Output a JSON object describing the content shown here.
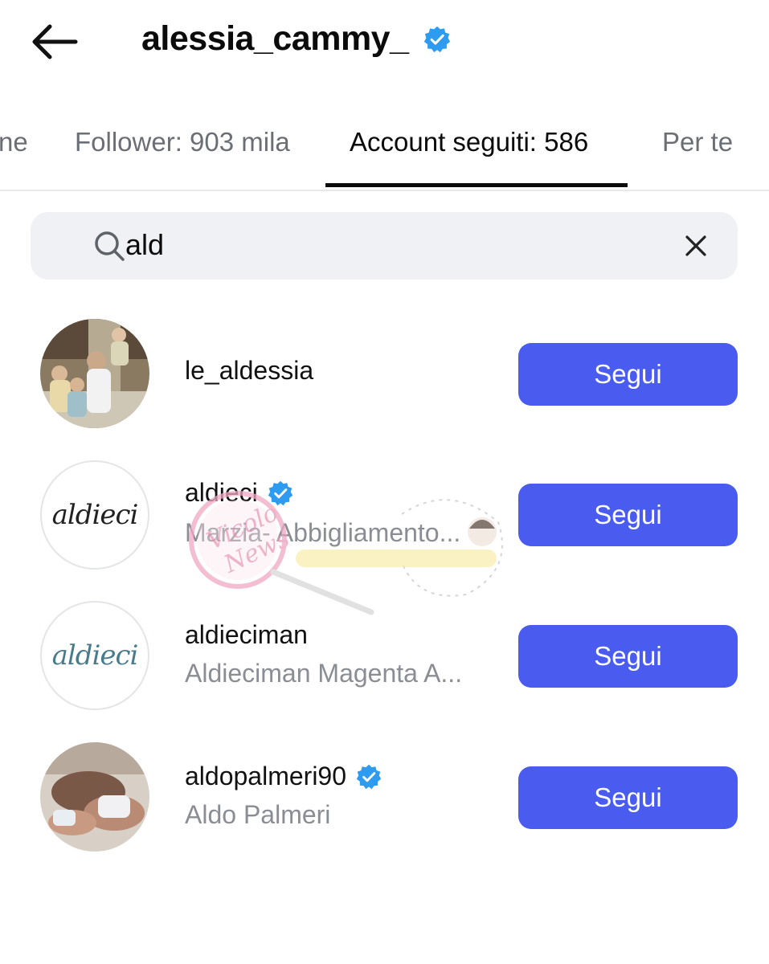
{
  "header": {
    "title": "alessia_cammy_"
  },
  "tabs": [
    {
      "label": "ne"
    },
    {
      "label": "Follower: 903 mila"
    },
    {
      "label": "Account seguiti: 586"
    },
    {
      "label": "Per te"
    }
  ],
  "search": {
    "value": "ald"
  },
  "rows": [
    {
      "username": "le_aldessia",
      "subtitle": "",
      "verified": false,
      "button": "Segui"
    },
    {
      "username": "aldieci",
      "subtitle": "Marzia- Abbigliamento...",
      "verified": true,
      "avatar_text": "aldieci",
      "button": "Segui"
    },
    {
      "username": "aldieciman",
      "subtitle": "Aldieciman Magenta A...",
      "verified": false,
      "avatar_text": "aldieci",
      "button": "Segui"
    },
    {
      "username": "aldopalmeri90",
      "subtitle": "Aldo Palmeri",
      "verified": true,
      "button": "Segui"
    }
  ],
  "colors": {
    "accent": "#4a5cf0",
    "verified": "#2d9cf0",
    "muted": "#8a8d93"
  },
  "watermark_text": "Vicolo delle News"
}
